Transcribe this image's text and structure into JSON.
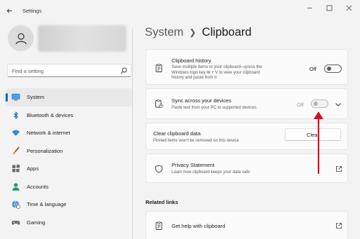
{
  "window": {
    "title": "Settings"
  },
  "sidebar": {
    "search_placeholder": "Find a setting",
    "items": [
      {
        "label": "System",
        "icon": "system-icon",
        "active": true
      },
      {
        "label": "Bluetooth & devices",
        "icon": "bluetooth-icon"
      },
      {
        "label": "Network & internet",
        "icon": "wifi-icon"
      },
      {
        "label": "Personalization",
        "icon": "brush-icon"
      },
      {
        "label": "Apps",
        "icon": "apps-icon"
      },
      {
        "label": "Accounts",
        "icon": "accounts-icon"
      },
      {
        "label": "Time & language",
        "icon": "globe-clock-icon"
      },
      {
        "label": "Gaming",
        "icon": "gamepad-icon"
      }
    ]
  },
  "breadcrumb": {
    "parent": "System",
    "current": "Clipboard"
  },
  "clipboard_history": {
    "title": "Clipboard history",
    "desc_line1": "Save multiple items to your clipboard—press the",
    "desc_line2": "Windows logo key ⊞ + V to view your clipboard",
    "desc_line3": "history and paste from it",
    "state": "Off"
  },
  "sync": {
    "title": "Sync across your devices",
    "desc": "Paste text from your PC to supported devices",
    "state": "Off"
  },
  "clear": {
    "title": "Clear clipboard data",
    "desc": "Pinned items won't be removed on this device",
    "button": "Clear"
  },
  "privacy": {
    "title": "Privacy Statement",
    "desc": "Learn how clipboard keeps your data safe"
  },
  "related": {
    "heading": "Related links",
    "help_label": "Get help with clipboard"
  },
  "colors": {
    "accent": "#0067c0",
    "annotation": "#d4121f"
  }
}
